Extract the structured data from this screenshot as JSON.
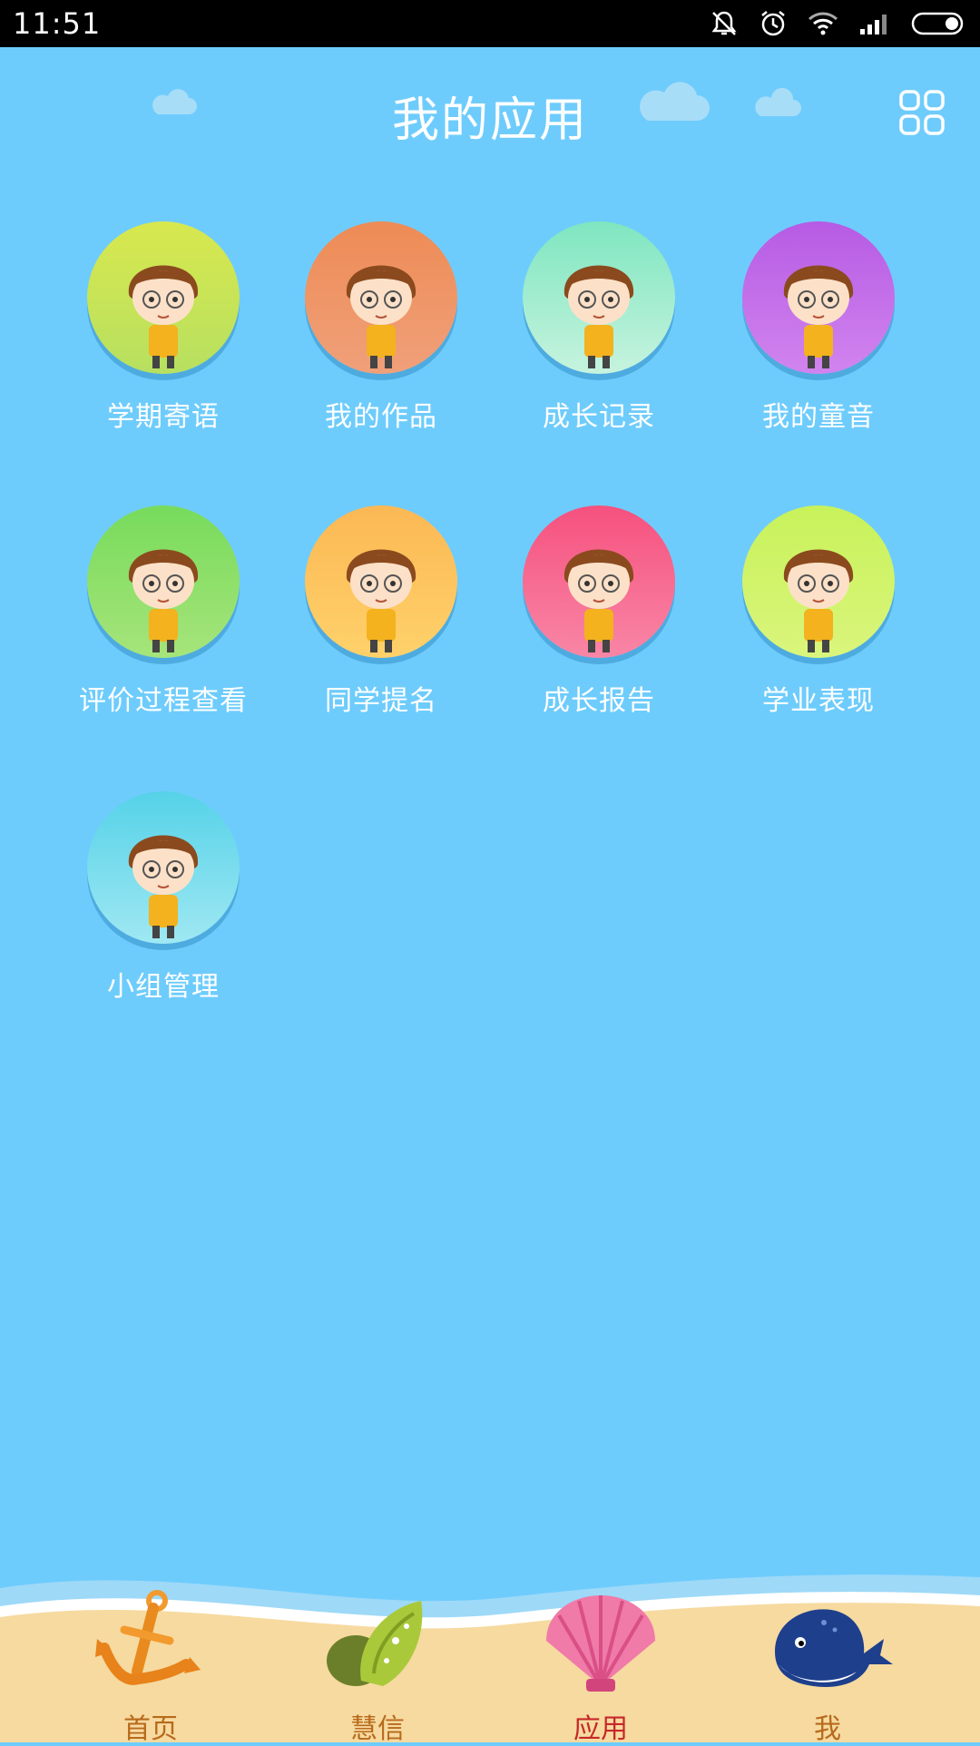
{
  "status_bar": {
    "time": "11:51",
    "icons": [
      "mute-icon",
      "alarm-icon",
      "wifi-icon",
      "signal-icon",
      "battery-icon"
    ]
  },
  "header": {
    "title": "我的应用",
    "grid_icon": "grid-icon"
  },
  "apps": [
    {
      "label": "学期寄语",
      "color_top": "#D8E84E",
      "color_bottom": "#B7E060"
    },
    {
      "label": "我的作品",
      "color_top": "#EE8B55",
      "color_bottom": "#F0A07A"
    },
    {
      "label": "成长记录",
      "color_top": "#7EE6C0",
      "color_bottom": "#C6F3DE"
    },
    {
      "label": "我的童音",
      "color_top": "#B65BE4",
      "color_bottom": "#D184EE"
    },
    {
      "label": "评价过程查看",
      "color_top": "#77DB5C",
      "color_bottom": "#A6E47A"
    },
    {
      "label": "同学提名",
      "color_top": "#FBB854",
      "color_bottom": "#FFD16A"
    },
    {
      "label": "成长报告",
      "color_top": "#F5517E",
      "color_bottom": "#F986A6"
    },
    {
      "label": "学业表现",
      "color_top": "#C8F25A",
      "color_bottom": "#DAF57C"
    },
    {
      "label": "小组管理",
      "color_top": "#55D2E8",
      "color_bottom": "#9FE8F2"
    }
  ],
  "tabbar": {
    "tabs": [
      {
        "label": "首页",
        "icon": "anchor-icon",
        "active": false
      },
      {
        "label": "慧信",
        "icon": "conch-icon",
        "active": false
      },
      {
        "label": "应用",
        "icon": "seashell-icon",
        "active": true
      },
      {
        "label": "我",
        "icon": "whale-icon",
        "active": false
      }
    ]
  }
}
